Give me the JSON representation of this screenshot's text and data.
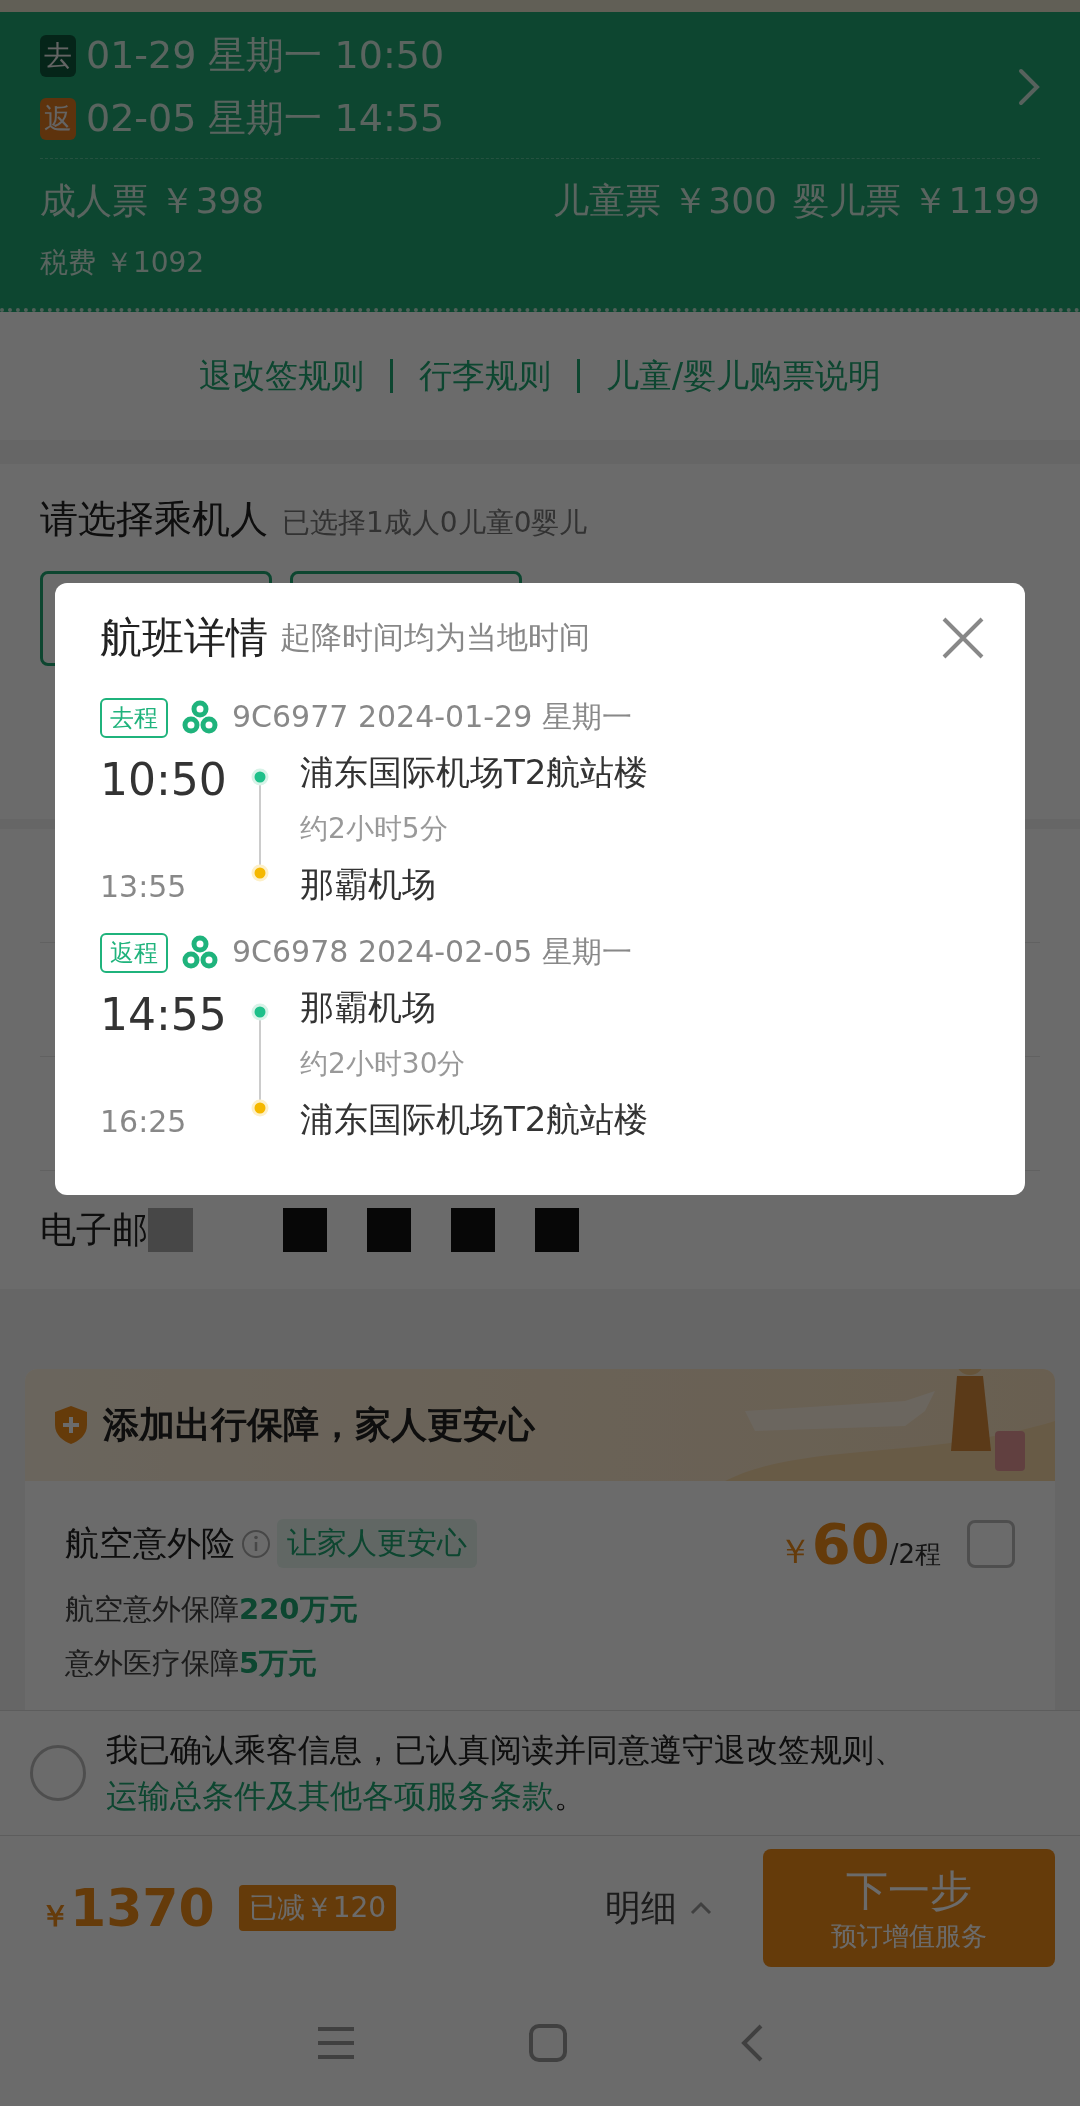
{
  "trips": [
    {
      "kind": "outbound",
      "tag": "去",
      "text": "01-29 星期一 10:50"
    },
    {
      "kind": "return",
      "tag": "返",
      "text": "02-05 星期一 14:55"
    }
  ],
  "fares": {
    "adult": "成人票 ￥398",
    "child": "儿童票 ￥300",
    "infant": "婴儿票 ￥1199",
    "tax": "税费 ￥1092"
  },
  "links": [
    "退改签规则",
    "行李规则",
    "儿童/婴儿购票说明"
  ],
  "passengers": {
    "title": "请选择乘机人",
    "summary": "已选择1成人0儿童0婴儿"
  },
  "email": {
    "label": "电子邮"
  },
  "insurance": {
    "banner": "添加出行保障，家人更安心",
    "name": "航空意外险",
    "tag": "让家人更安心",
    "currency": "￥",
    "price": "60",
    "unit": "/2程",
    "checked": false,
    "lines": [
      {
        "label": "航空意外保障",
        "value": "220万元"
      },
      {
        "label": "意外医疗保障",
        "value": "5万元"
      }
    ]
  },
  "agreement": {
    "checked": false,
    "text": "我已确认乘客信息，已认真阅读并同意遵守退改签规则、",
    "link": "运输总条件及其他各项服务条款",
    "end": "。"
  },
  "bottom_bar": {
    "currency": "￥",
    "total": "1370",
    "discount": "已减￥120",
    "detail": "明细",
    "next": "下一步",
    "next_sub": "预订增值服务"
  },
  "modal": {
    "title": "航班详情",
    "subtitle": "起降时间均为当地时间",
    "legs": [
      {
        "tag": "去程",
        "flight": "9C6977 2024-01-29 星期一",
        "dep_time": "10:50",
        "dep_airport": "浦东国际机场T2航站楼",
        "duration": "约2小时5分",
        "arr_time": "13:55",
        "arr_airport": "那霸机场"
      },
      {
        "tag": "返程",
        "flight": "9C6978 2024-02-05 星期一",
        "dep_time": "14:55",
        "dep_airport": "那霸机场",
        "duration": "约2小时30分",
        "arr_time": "16:25",
        "arr_airport": "浦东国际机场T2航站楼"
      }
    ]
  }
}
